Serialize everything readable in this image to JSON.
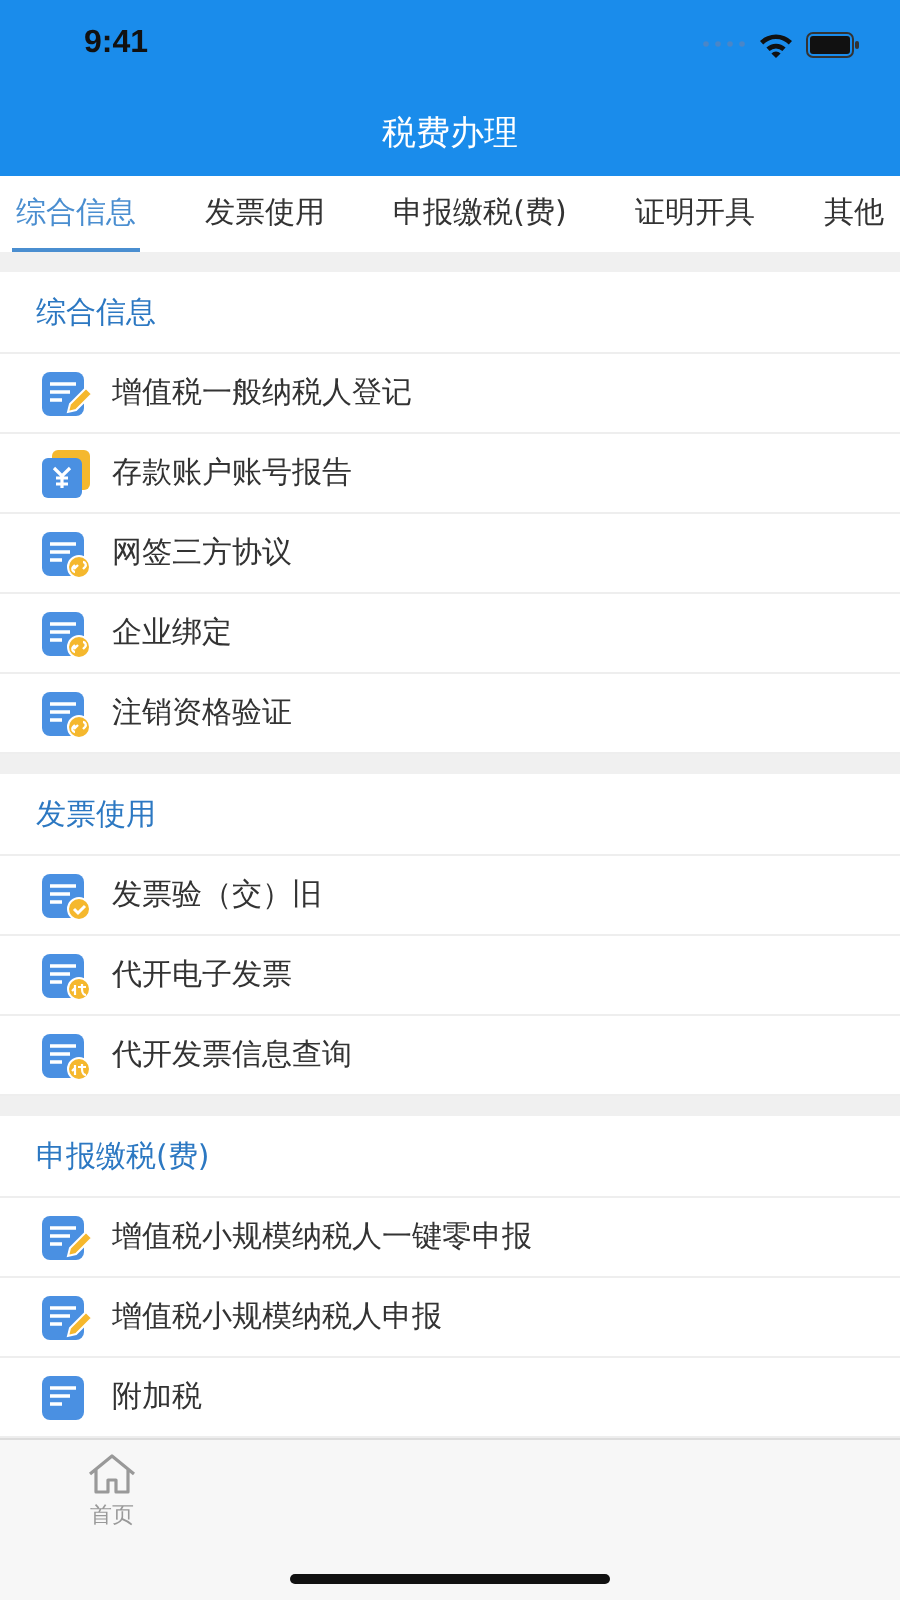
{
  "status_bar": {
    "time": "9:41"
  },
  "nav_bar": {
    "title": "税费办理"
  },
  "tabs": [
    {
      "label": "综合信息",
      "selected": true
    },
    {
      "label": "发票使用",
      "selected": false
    },
    {
      "label": "申报缴税(费)",
      "selected": false
    },
    {
      "label": "证明开具",
      "selected": false
    },
    {
      "label": "其他",
      "selected": false
    }
  ],
  "sections": [
    {
      "title": "综合信息",
      "items": [
        {
          "label": "增值税一般纳税人登记",
          "kind": "edit"
        },
        {
          "label": "存款账户账号报告",
          "kind": "money"
        },
        {
          "label": "网签三方协议",
          "kind": "link"
        },
        {
          "label": "企业绑定",
          "kind": "link"
        },
        {
          "label": "注销资格验证",
          "kind": "link"
        }
      ]
    },
    {
      "title": "发票使用",
      "items": [
        {
          "label": "发票验（交）旧",
          "kind": "check"
        },
        {
          "label": "代开电子发票",
          "kind": "proxy"
        },
        {
          "label": "代开发票信息查询",
          "kind": "proxy"
        }
      ]
    },
    {
      "title": "申报缴税(费)",
      "items": [
        {
          "label": "增值税小规模纳税人一键零申报",
          "kind": "edit"
        },
        {
          "label": "增值税小规模纳税人申报",
          "kind": "edit"
        },
        {
          "label": "附加税",
          "kind": "doc"
        }
      ]
    }
  ],
  "bottom_tabs": [
    {
      "label": "首页"
    }
  ]
}
